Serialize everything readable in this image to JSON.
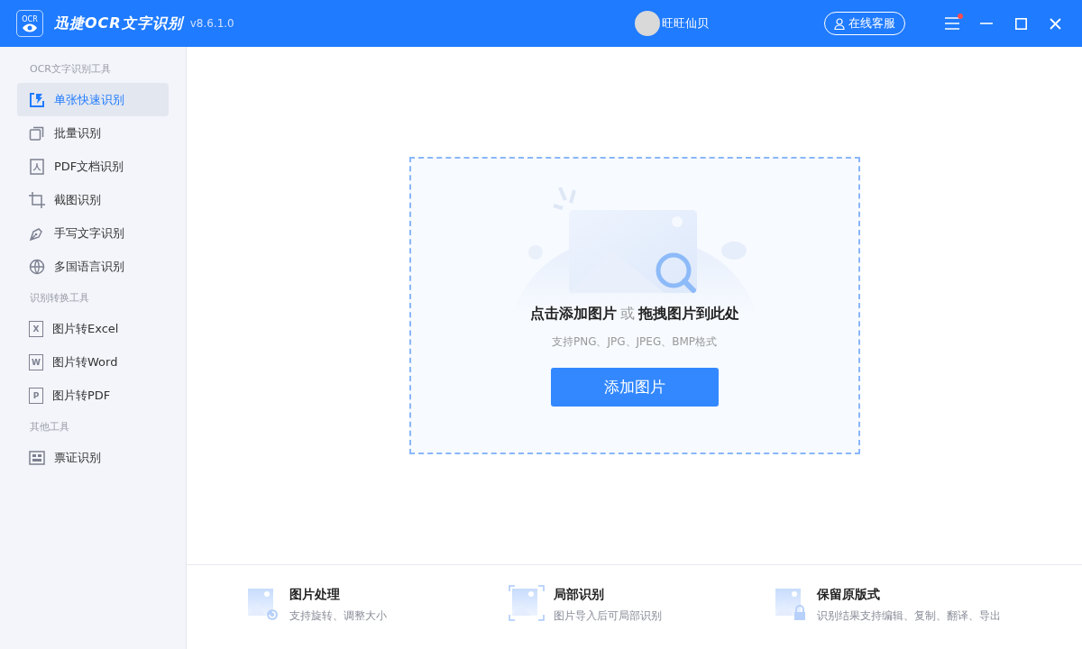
{
  "header": {
    "logo_text": "OCR",
    "title": "迅捷OCR文字识别",
    "version": "v8.6.1.0",
    "user_name": "旺旺仙贝",
    "support_button": "在线客服",
    "menu_notification": true
  },
  "sidebar": {
    "groups": [
      {
        "title": "OCR文字识别工具",
        "items": [
          {
            "label": "单张快速识别",
            "kind": "single",
            "selected": true
          },
          {
            "label": "批量识别",
            "kind": "batch",
            "selected": false
          },
          {
            "label": "PDF文档识别",
            "kind": "pdf",
            "selected": false
          },
          {
            "label": "截图识别",
            "kind": "crop",
            "selected": false
          },
          {
            "label": "手写文字识别",
            "kind": "pen",
            "selected": false
          },
          {
            "label": "多国语言识别",
            "kind": "globe",
            "selected": false
          }
        ]
      },
      {
        "title": "识别转换工具",
        "items": [
          {
            "label": "图片转Excel",
            "kind": "file",
            "letter": "X",
            "selected": false
          },
          {
            "label": "图片转Word",
            "kind": "file",
            "letter": "W",
            "selected": false
          },
          {
            "label": "图片转PDF",
            "kind": "file",
            "letter": "P",
            "selected": false
          }
        ]
      },
      {
        "title": "其他工具",
        "items": [
          {
            "label": "票证识别",
            "kind": "card",
            "selected": false
          }
        ]
      }
    ]
  },
  "drop_zone": {
    "title": [
      "点击添加图片",
      "或",
      "拖拽图片到此处"
    ],
    "formats": "支持PNG、JPG、JPEG、BMP格式",
    "button": "添加图片"
  },
  "features": [
    {
      "title": "图片处理",
      "description": "支持旋转、调整大小",
      "kind": "rotate"
    },
    {
      "title": "局部识别",
      "description": "图片导入后可局部识别",
      "kind": "partial"
    },
    {
      "title": "保留原版式",
      "description": "识别结果支持编辑、复制、翻译、导出",
      "kind": "lock"
    }
  ]
}
